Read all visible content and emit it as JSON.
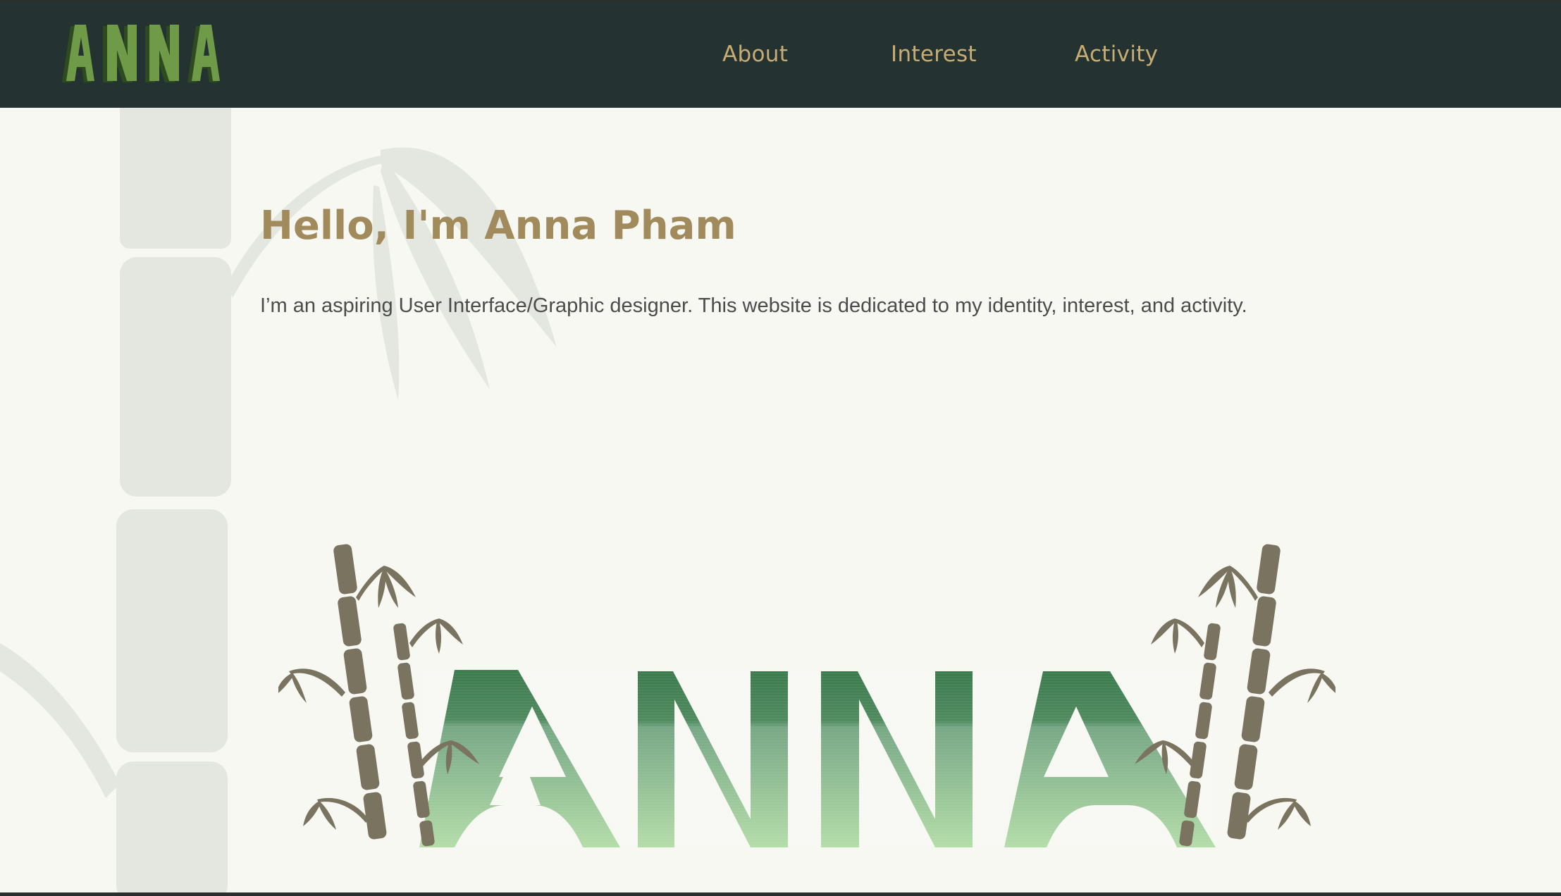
{
  "brand": {
    "logo_text": "ANNA"
  },
  "nav": {
    "items": [
      {
        "label": "About"
      },
      {
        "label": "Interest"
      },
      {
        "label": "Activity"
      }
    ]
  },
  "hero": {
    "title": "Hello, I'm Anna Pham",
    "intro": "I’m an aspiring User Interface/Graphic designer. This website is dedicated to my identity, interest, and activity."
  },
  "artwork": {
    "wordmark": "ANNA"
  },
  "colors": {
    "navbar_bg": "#243232",
    "nav_link": "#c7ad72",
    "page_bg": "#f8f8f3",
    "title": "#a18b5d",
    "body_text": "#4b4b4b",
    "bamboo_brown": "#7a7360",
    "bamboo_pale": "#e3e7df",
    "logo_green_light": "#6f9a48",
    "logo_green_dark": "#2e4a1f",
    "wordmark_green_top": "#3a7a4c",
    "wordmark_green_bottom": "#b3dca8"
  }
}
